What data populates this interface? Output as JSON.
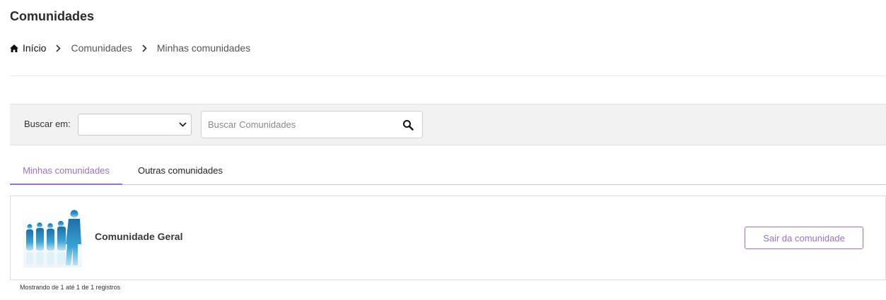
{
  "page": {
    "title": "Comunidades"
  },
  "breadcrumb": {
    "home": {
      "label": "Início",
      "icon": "home-icon"
    },
    "separator_icon": "chevron-right-icon",
    "items": [
      {
        "label": "Comunidades"
      },
      {
        "label": "Minhas comunidades"
      }
    ]
  },
  "filter": {
    "label": "Buscar em:",
    "select_value": "",
    "search": {
      "placeholder": "Buscar Comunidades",
      "value": "",
      "icon": "search-icon"
    }
  },
  "tabs": [
    {
      "label": "Minhas comunidades",
      "active": true
    },
    {
      "label": "Outras comunidades",
      "active": false
    }
  ],
  "communities": [
    {
      "name": "Comunidade Geral",
      "action_label": "Sair da comunidade"
    }
  ],
  "pagination": {
    "info": "Mostrando de 1 até 1 de 1 registros"
  },
  "colors": {
    "accent": "#9a72c6",
    "filter_bg": "#f2f2f2",
    "border": "#dcdcdc"
  }
}
